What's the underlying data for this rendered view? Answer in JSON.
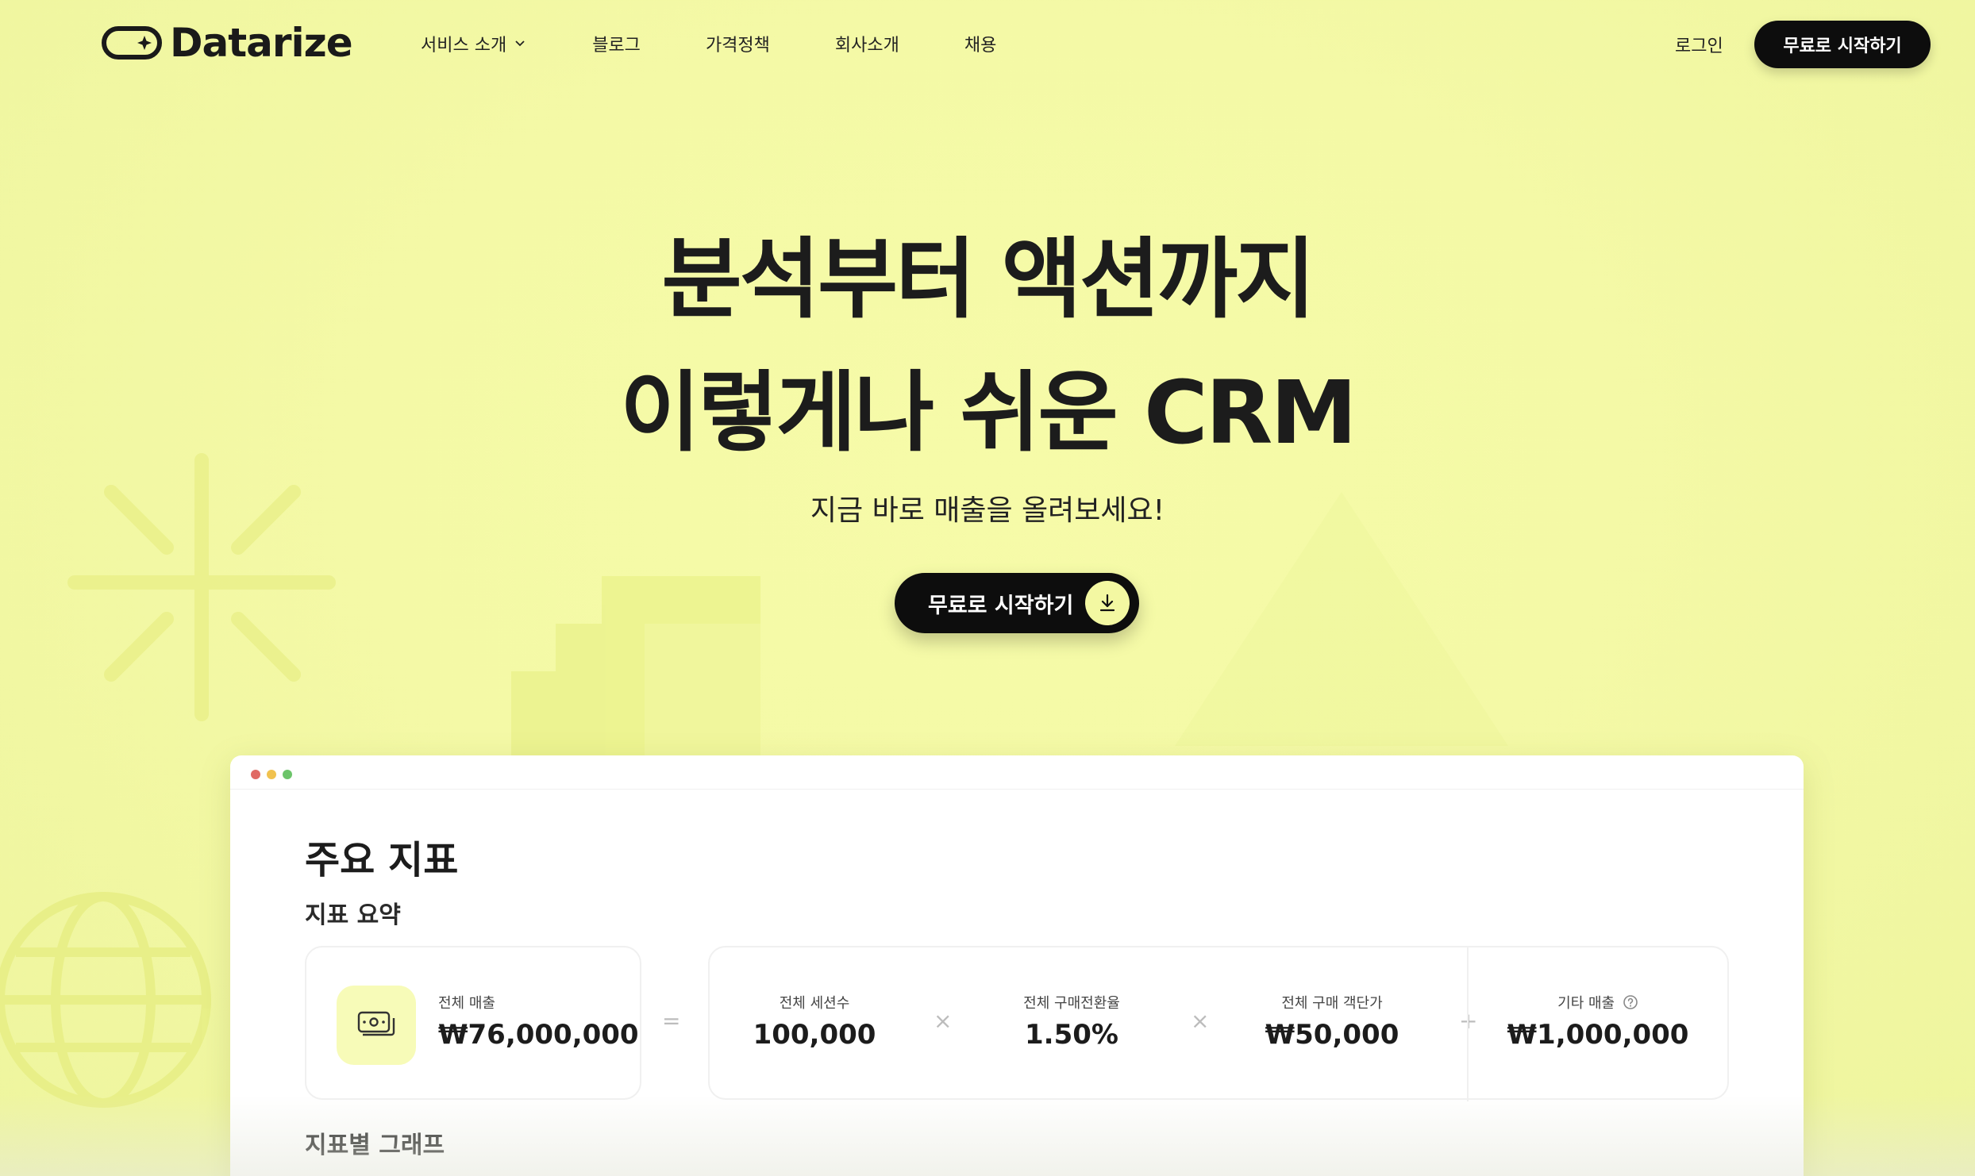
{
  "nav": {
    "logo_text": "Datarize",
    "links": [
      {
        "label": "서비스 소개",
        "has_dropdown": true
      },
      {
        "label": "블로그"
      },
      {
        "label": "가격정책"
      },
      {
        "label": "회사소개"
      },
      {
        "label": "채용"
      }
    ],
    "login_label": "로그인",
    "cta_label": "무료로 시작하기"
  },
  "hero": {
    "title_line1": "분석부터 액션까지",
    "title_line2": "이렇게나 쉬운 CRM",
    "subtitle": "지금 바로 매출을 올려보세요!",
    "cta_label": "무료로 시작하기",
    "cta_icon": "download-arrow-icon"
  },
  "dashboard": {
    "window_dots": [
      "#e06a64",
      "#f1c24f",
      "#6cc46a"
    ],
    "title": "주요 지표",
    "summary_heading": "지표 요약",
    "total": {
      "label": "전체 매출",
      "value": "₩76,000,000",
      "icon": "money-icon"
    },
    "equals_symbol": "=",
    "metrics": [
      {
        "label": "전체 세션수",
        "value": "100,000"
      },
      {
        "label": "전체 구매전환율",
        "value": "1.50%"
      },
      {
        "label": "전체 구매 객단가",
        "value": "₩50,000"
      },
      {
        "label": "기타 매출",
        "value": "₩1,000,000",
        "help_icon": "question-circle-icon"
      }
    ],
    "operators": [
      "×",
      "×",
      "+"
    ],
    "graph_heading": "지표별 그래프"
  },
  "colors": {
    "background": "#f4f9a6",
    "accent": "#f3f8a2",
    "button": "#0d0d0d"
  }
}
